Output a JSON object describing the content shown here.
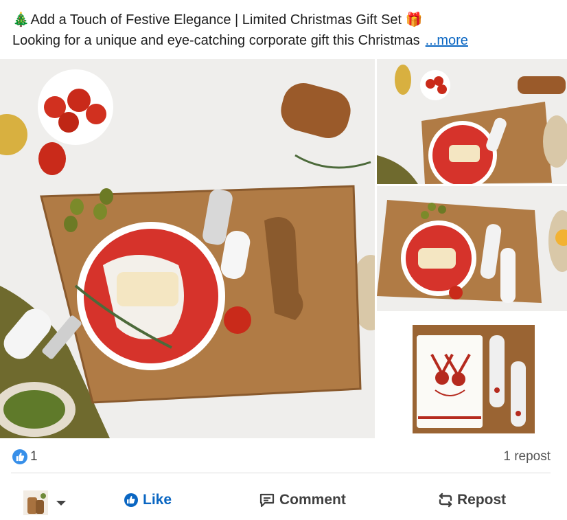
{
  "post": {
    "headline": "Add a Touch of Festive Elegance | Limited Christmas Gift Set",
    "body_preview": "Looking for a unique and eye-catching corporate gift this Christmas",
    "more_label": "...more",
    "gift_emoji": "🎁",
    "tree_emoji": "🎄"
  },
  "images": [
    {
      "name": "main-product-photo",
      "subject": "acacia cheese board with red reindeer plate, knife and fork"
    },
    {
      "name": "thumbnail-top-right",
      "subject": "cheese board top view"
    },
    {
      "name": "thumbnail-middle-right",
      "subject": "cheese board close-up"
    },
    {
      "name": "thumbnail-bottom-right",
      "subject": "board with reindeer plate and utensils"
    }
  ],
  "stats": {
    "reaction_count": "1",
    "repost_count": "1 repost"
  },
  "actions": {
    "like": "Like",
    "comment": "Comment",
    "repost": "Repost"
  },
  "colors": {
    "accent": "#0a66c2",
    "reaction": "#378fe9",
    "wood": "#a8723f",
    "festive_red": "#d6332b"
  }
}
